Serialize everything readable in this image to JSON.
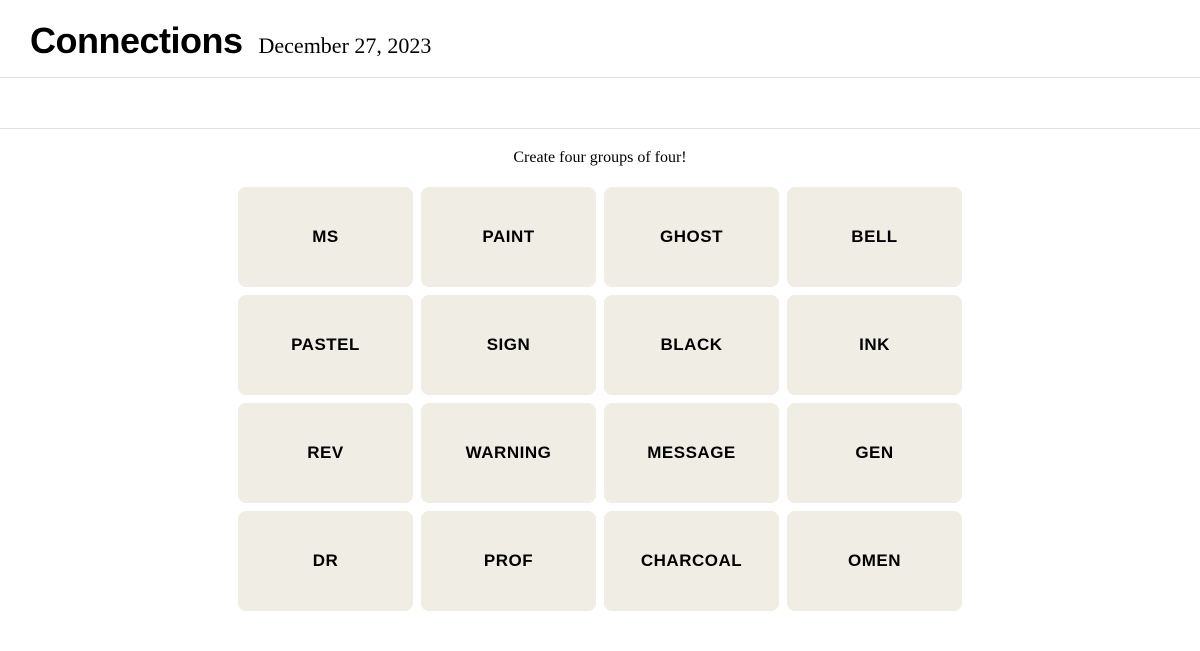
{
  "header": {
    "title": "Connections",
    "date": "December 27, 2023"
  },
  "game": {
    "instruction": "Create four groups of four!",
    "tiles": [
      {
        "id": 0,
        "label": "MS"
      },
      {
        "id": 1,
        "label": "PAINT"
      },
      {
        "id": 2,
        "label": "GHOST"
      },
      {
        "id": 3,
        "label": "BELL"
      },
      {
        "id": 4,
        "label": "PASTEL"
      },
      {
        "id": 5,
        "label": "SIGN"
      },
      {
        "id": 6,
        "label": "BLACK"
      },
      {
        "id": 7,
        "label": "INK"
      },
      {
        "id": 8,
        "label": "REV"
      },
      {
        "id": 9,
        "label": "WARNING"
      },
      {
        "id": 10,
        "label": "MESSAGE"
      },
      {
        "id": 11,
        "label": "GEN"
      },
      {
        "id": 12,
        "label": "DR"
      },
      {
        "id": 13,
        "label": "PROF"
      },
      {
        "id": 14,
        "label": "CHARCOAL"
      },
      {
        "id": 15,
        "label": "OMEN"
      }
    ]
  }
}
